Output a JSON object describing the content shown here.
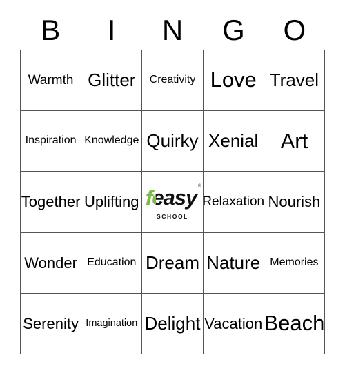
{
  "card": {
    "title_letters": [
      "B",
      "I",
      "N",
      "G",
      "O"
    ],
    "columns": 5,
    "rows": 5,
    "border_color": "#555555",
    "background_color": "#ffffff",
    "text_color": "#000000"
  },
  "free_space": {
    "row": 2,
    "col": 2,
    "logo_word": "feasy",
    "logo_subtitle": "SCHOOL",
    "logo_trademark": "®",
    "logo_accent_color": "#76c043",
    "logo_body_color": "#111111",
    "logo_outline_color": "#ffffff"
  },
  "cells": [
    [
      {
        "label": "Warmth",
        "size": "md"
      },
      {
        "label": "Glitter",
        "size": "xl"
      },
      {
        "label": "Creativity",
        "size": "sm"
      },
      {
        "label": "Love",
        "size": "xxl"
      },
      {
        "label": "Travel",
        "size": "xl"
      }
    ],
    [
      {
        "label": "Inspiration",
        "size": "sm"
      },
      {
        "label": "Knowledge",
        "size": "sm"
      },
      {
        "label": "Quirky",
        "size": "xl"
      },
      {
        "label": "Xenial",
        "size": "xl"
      },
      {
        "label": "Art",
        "size": "xxl"
      }
    ],
    [
      {
        "label": "Together",
        "size": "lg"
      },
      {
        "label": "Uplifting",
        "size": "lg"
      },
      {
        "label": "",
        "size": "md"
      },
      {
        "label": "Relaxation",
        "size": "md"
      },
      {
        "label": "Nourish",
        "size": "lg"
      }
    ],
    [
      {
        "label": "Wonder",
        "size": "lg"
      },
      {
        "label": "Education",
        "size": "sm"
      },
      {
        "label": "Dream",
        "size": "xl"
      },
      {
        "label": "Nature",
        "size": "xl"
      },
      {
        "label": "Memories",
        "size": "sm"
      }
    ],
    [
      {
        "label": "Serenity",
        "size": "lg"
      },
      {
        "label": "Imagination",
        "size": "xs"
      },
      {
        "label": "Delight",
        "size": "xl"
      },
      {
        "label": "Vacation",
        "size": "lg"
      },
      {
        "label": "Beach",
        "size": "xxl"
      }
    ]
  ]
}
